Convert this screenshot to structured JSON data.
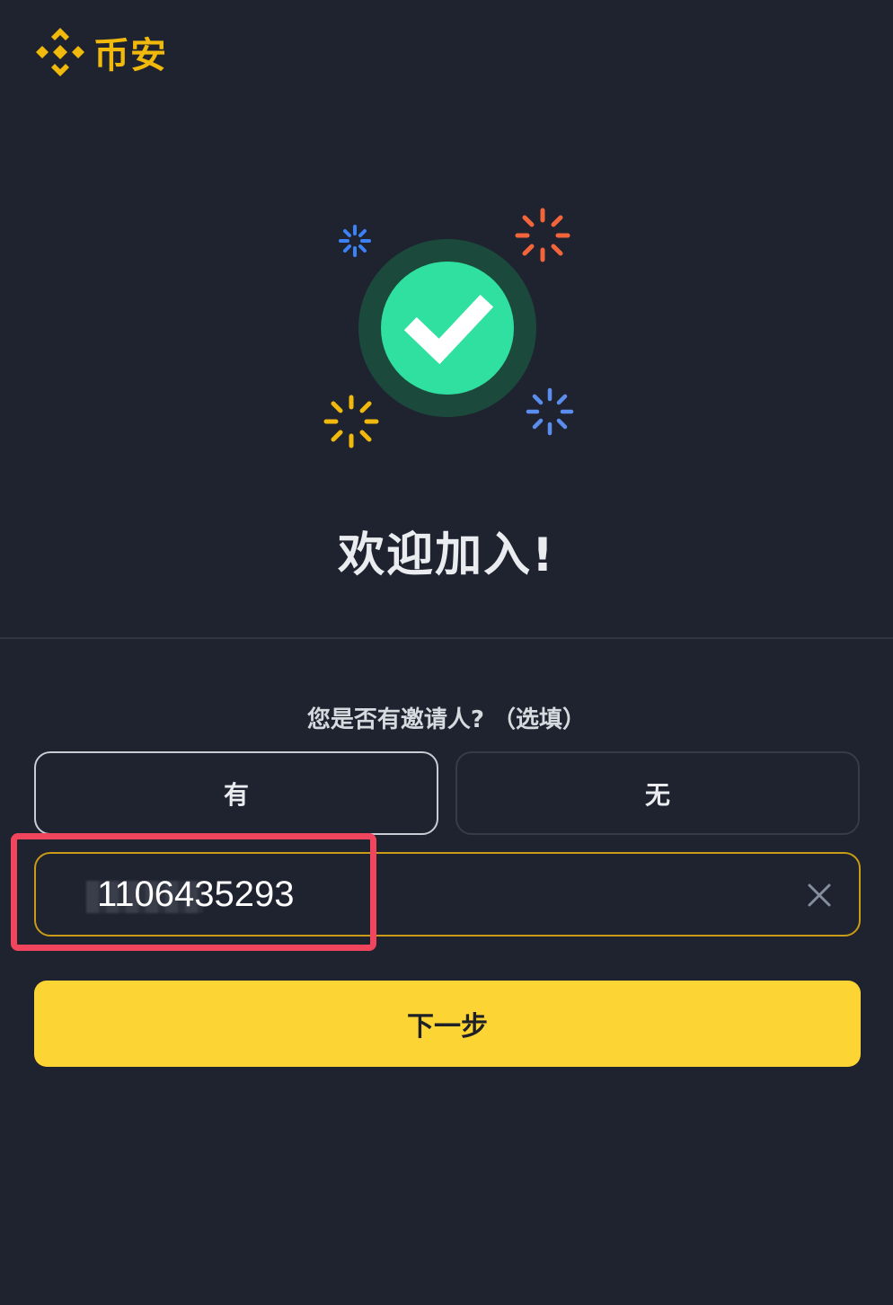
{
  "brand": {
    "name": "币安",
    "icon": "binance-logo-icon",
    "color": "#f0b90b"
  },
  "hero": {
    "icon": "success-check-icon",
    "check_color": "#2fe0a0",
    "ring_color": "#1b4a3c",
    "sparkle_colors": [
      "#3b82f6",
      "#f2643a",
      "#f0b90b",
      "#5b8def"
    ]
  },
  "welcome": {
    "title": "欢迎加入!"
  },
  "referral": {
    "question": "您是否有邀请人? （选填）",
    "options": {
      "yes_label": "有",
      "no_label": "无"
    },
    "selected": "yes_label",
    "input": {
      "value": "1106435293",
      "clear_icon": "close-icon"
    }
  },
  "actions": {
    "next_label": "下一步",
    "accent": "#fcd535"
  },
  "annotation": {
    "highlight_color": "#f0455c"
  }
}
